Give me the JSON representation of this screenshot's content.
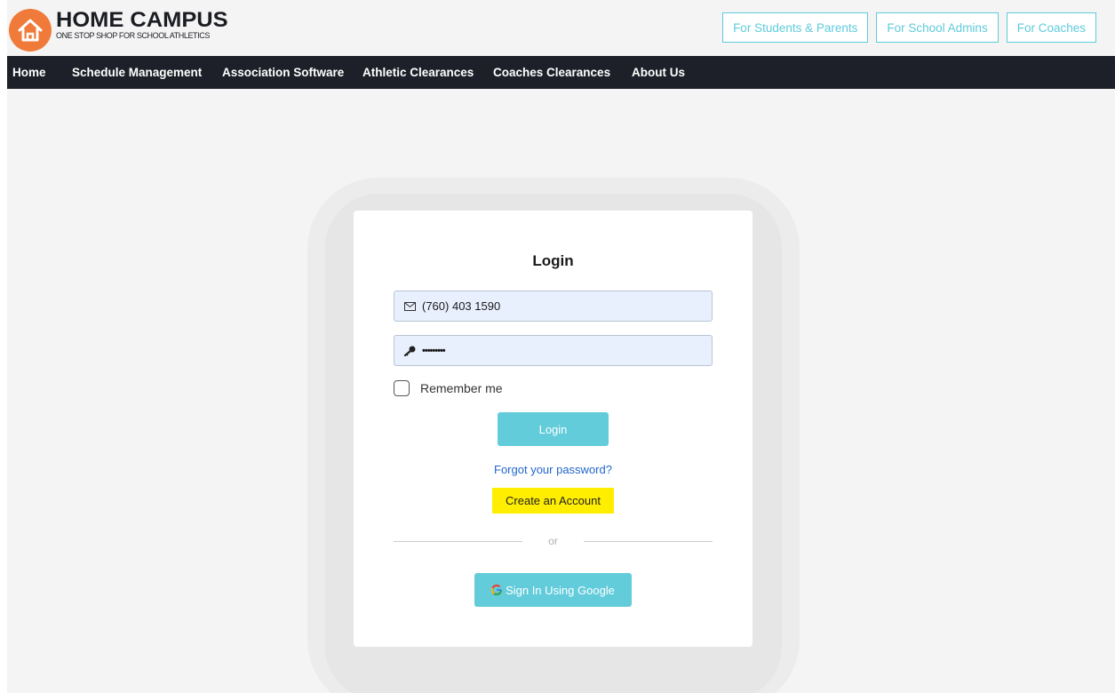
{
  "brand": {
    "title": "HOME CAMPUS",
    "tagline": "ONE STOP SHOP FOR SCHOOL ATHLETICS",
    "logo_icon": "house-icon",
    "accent": "#ef7a3a"
  },
  "audience_links": [
    {
      "label": "For Students & Parents"
    },
    {
      "label": "For School Admins"
    },
    {
      "label": "For Coaches"
    }
  ],
  "nav": {
    "items": [
      {
        "label": "Home"
      },
      {
        "label": "Schedule Management"
      },
      {
        "label": "Association Software"
      },
      {
        "label": "Athletic Clearances"
      },
      {
        "label": "Coaches Clearances"
      },
      {
        "label": "About Us"
      }
    ]
  },
  "login": {
    "title": "Login",
    "phone_value": "(760) 403 1590",
    "phone_icon": "envelope-icon",
    "password_value": "•••••••••",
    "password_icon": "key-icon",
    "remember_label": "Remember me",
    "remember_checked": false,
    "login_button": "Login",
    "forgot_link": "Forgot your password?",
    "create_link": "Create an Account",
    "divider_text": "or",
    "google_button": "Sign In Using Google"
  },
  "colors": {
    "button": "#62ccdb",
    "nav_bg": "#1d2028",
    "highlight": "#ffee00",
    "link": "#2266cc"
  }
}
